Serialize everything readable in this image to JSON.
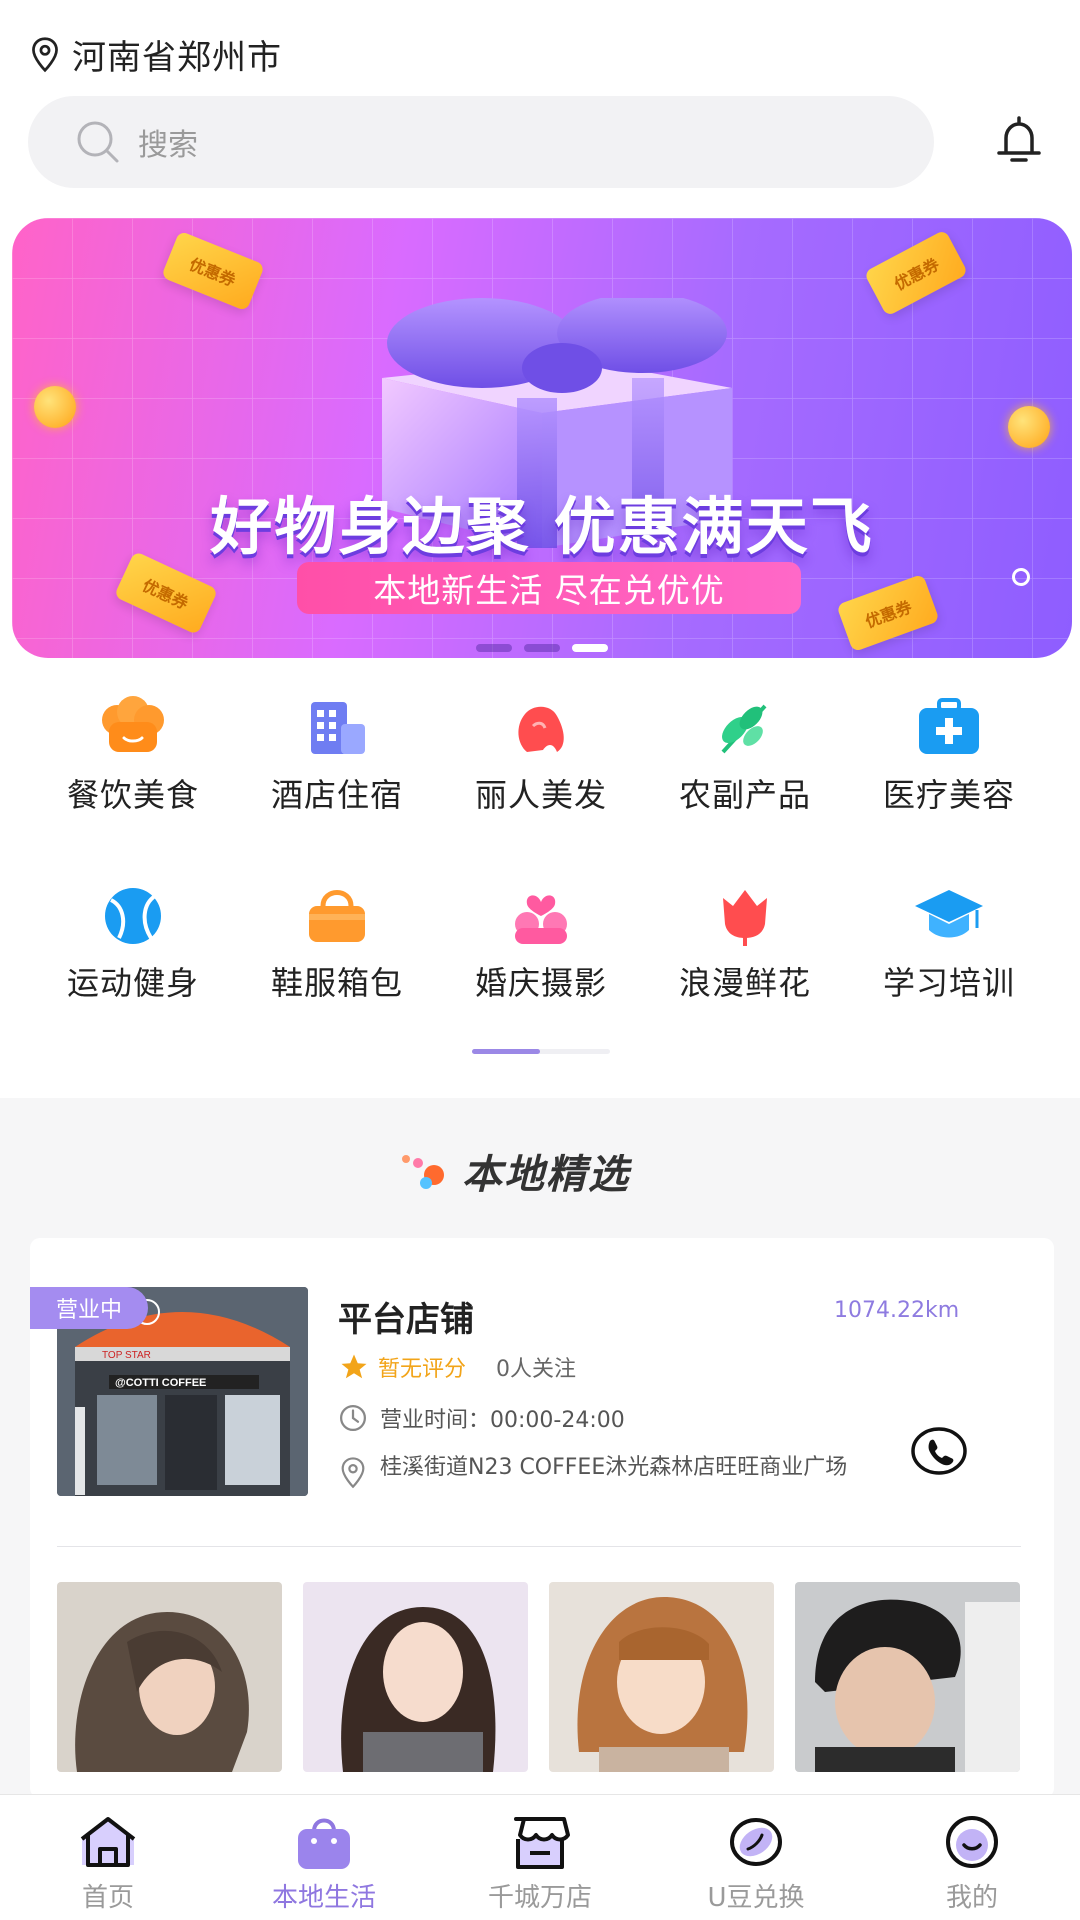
{
  "header": {
    "location": "河南省郑州市",
    "search_placeholder": "搜索"
  },
  "banner": {
    "title": "好物身边聚  优惠满天飞",
    "subtitle": "本地新生活 尽在兑优优",
    "coupon_label": "优惠券",
    "active_slide": 3,
    "slide_count": 3
  },
  "categories": [
    {
      "label": "餐饮美食",
      "icon": "chef-hat-icon"
    },
    {
      "label": "酒店住宿",
      "icon": "hotel-building-icon"
    },
    {
      "label": "丽人美发",
      "icon": "woman-hair-icon"
    },
    {
      "label": "农副产品",
      "icon": "wheat-leaf-icon"
    },
    {
      "label": "医疗美容",
      "icon": "medical-kit-icon"
    },
    {
      "label": "运动健身",
      "icon": "tennis-ball-icon"
    },
    {
      "label": "鞋服箱包",
      "icon": "handbag-icon"
    },
    {
      "label": "婚庆摄影",
      "icon": "couple-heart-icon"
    },
    {
      "label": "浪漫鲜花",
      "icon": "rose-flower-icon"
    },
    {
      "label": "学习培训",
      "icon": "graduation-cap-icon"
    }
  ],
  "section": {
    "title": "本地精选"
  },
  "store": {
    "status": "营业中",
    "name": "平台店铺",
    "distance": "1074.22km",
    "rating": "暂无评分",
    "followers": "0人关注",
    "hours": "营业时间：00:00-24:00",
    "address": "桂溪街道N23 COFFEE沐光森林店旺旺商业广场",
    "storefront_signs": [
      "TOP STAR",
      "@COTTI COFFEE"
    ]
  },
  "tabbar": [
    {
      "label": "首页",
      "icon": "home-icon",
      "active": false
    },
    {
      "label": "本地生活",
      "icon": "shopping-bag-icon",
      "active": true
    },
    {
      "label": "千城万店",
      "icon": "store-icon",
      "active": false
    },
    {
      "label": "U豆兑换",
      "icon": "bean-icon",
      "active": false
    },
    {
      "label": "我的",
      "icon": "profile-icon",
      "active": false
    }
  ],
  "colors": {
    "accent": "#8f77e0",
    "badge": "#a48cf0",
    "rating": "#f2a419"
  }
}
